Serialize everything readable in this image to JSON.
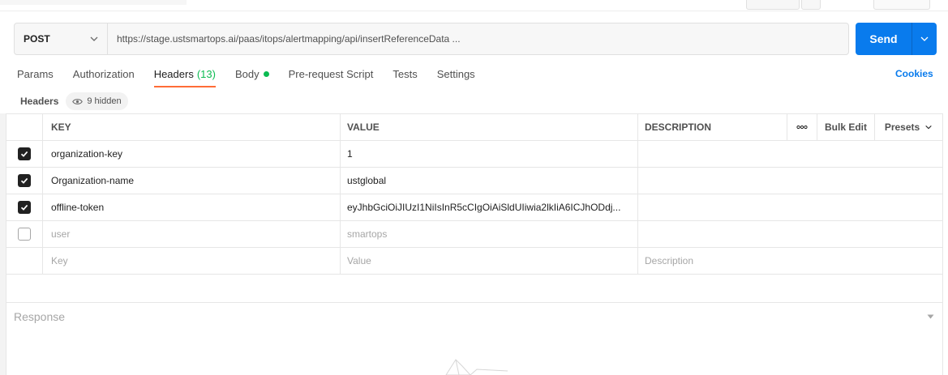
{
  "request": {
    "method": "POST",
    "url": "https://stage.ustsmartops.ai/paas/itops/alertmapping/api/insertReferenceData ...",
    "send_label": "Send"
  },
  "tabs": [
    {
      "label": "Params"
    },
    {
      "label": "Authorization"
    },
    {
      "label": "Headers",
      "count": "(13)"
    },
    {
      "label": "Body"
    },
    {
      "label": "Pre-request Script"
    },
    {
      "label": "Tests"
    },
    {
      "label": "Settings"
    }
  ],
  "cookies_label": "Cookies",
  "headers_section": {
    "label": "Headers",
    "hidden_label": "9 hidden"
  },
  "table": {
    "columns": {
      "key": "KEY",
      "value": "VALUE",
      "description": "DESCRIPTION",
      "more": "ooo",
      "bulk_edit": "Bulk Edit",
      "presets": "Presets"
    },
    "rows": [
      {
        "checked": true,
        "key": "organization-key",
        "value": "1",
        "description": ""
      },
      {
        "checked": true,
        "key": "Organization-name",
        "value": "ustglobal",
        "description": ""
      },
      {
        "checked": true,
        "key": "offline-token",
        "value": "eyJhbGciOiJIUzI1NiIsInR5cCIgOiAiSldUIiwia2lkIiA6ICJhODdj...",
        "description": ""
      },
      {
        "checked": false,
        "key": "user",
        "value": "smartops",
        "description": ""
      }
    ],
    "new_row": {
      "key_placeholder": "Key",
      "value_placeholder": "Value",
      "description_placeholder": "Description"
    }
  },
  "response": {
    "label": "Response"
  },
  "colors": {
    "send": "#097bed",
    "accent": "#ff6c37",
    "success": "#0cbb52",
    "link": "#097bed"
  }
}
